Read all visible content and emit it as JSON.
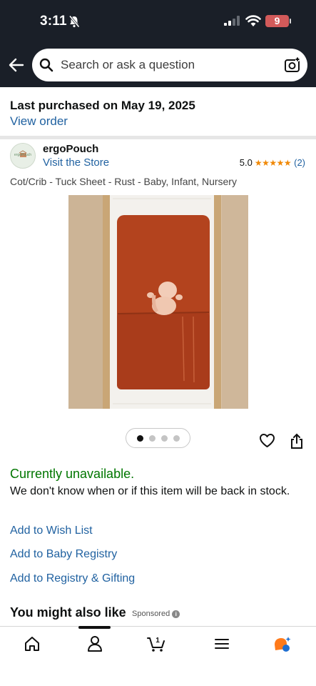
{
  "status_bar": {
    "time": "3:11",
    "battery": "9"
  },
  "search": {
    "placeholder": "Search or ask a question"
  },
  "purchase": {
    "title": "Last purchased on May 19, 2025",
    "link": "View order"
  },
  "brand": {
    "name": "ergoPouch",
    "store_link": "Visit the Store",
    "logo_text": "ergoPouch",
    "rating": "5.0",
    "stars": "★★★★★",
    "review_count": "(2)"
  },
  "product": {
    "title": "Cot/Crib - Tuck Sheet - Rust - Baby, Infant, Nursery",
    "image_count": 4,
    "active_image": 1
  },
  "availability": {
    "status": "Currently unavailable.",
    "message": "We don't know when or if this item will be back in stock."
  },
  "actions": {
    "wish_list": "Add to Wish List",
    "baby_registry": "Add to Baby Registry",
    "registry_gifting": "Add to Registry & Gifting"
  },
  "recommendations": {
    "title": "You might also like",
    "sponsored": "Sponsored"
  },
  "tabbar": {
    "items": [
      "home-icon",
      "account-icon",
      "cart-icon",
      "menu-icon",
      "rufus-icon"
    ],
    "cart_count": "1"
  },
  "colors": {
    "header_bg": "#1a1f28",
    "link": "#2162a1",
    "available": "#007600",
    "star": "#f08804",
    "battery": "#d25a5a"
  }
}
